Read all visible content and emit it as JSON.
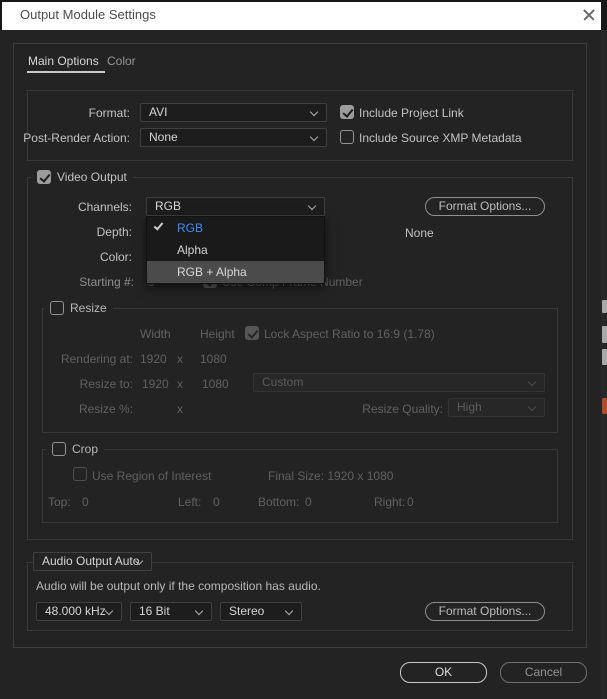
{
  "window": {
    "title": "Output Module Settings"
  },
  "tabs": [
    {
      "label": "Main Options",
      "active": true
    },
    {
      "label": "Color",
      "active": false
    }
  ],
  "format_section": {
    "format_label": "Format:",
    "format_value": "AVI",
    "post_render_label": "Post-Render Action:",
    "post_render_value": "None",
    "include_project_link": "Include Project Link",
    "include_project_link_checked": true,
    "include_xmp": "Include Source XMP Metadata",
    "include_xmp_checked": false
  },
  "video_output": {
    "legend": "Video Output",
    "checked": true,
    "channels_label": "Channels:",
    "channels_value": "RGB",
    "format_options_label": "Format Options...",
    "depth_label": "Depth:",
    "depth_right_text": "None",
    "color_label": "Color:",
    "starting_label": "Starting #:",
    "starting_value": "0",
    "use_comp_frame_label": "Use Comp Frame Number",
    "use_comp_frame_checked": true
  },
  "channels_menu": {
    "items": [
      {
        "label": "RGB",
        "checked": true,
        "state": "selected"
      },
      {
        "label": "Alpha",
        "checked": false,
        "state": "normal"
      },
      {
        "label": "RGB + Alpha",
        "checked": false,
        "state": "hover"
      }
    ]
  },
  "resize": {
    "legend": "Resize",
    "checked": false,
    "width_header": "Width",
    "height_header": "Height",
    "lock_label": "Lock Aspect Ratio to 16:9 (1.78)",
    "lock_checked": true,
    "rendering_label": "Rendering at:",
    "rendering_width": "1920",
    "rendering_height": "1080",
    "sep": "x",
    "resize_to_label": "Resize to:",
    "resize_to_width": "1920",
    "resize_to_height": "1080",
    "preset_value": "Custom",
    "resize_pct_label": "Resize %:",
    "quality_label": "Resize Quality:",
    "quality_value": "High"
  },
  "crop": {
    "legend": "Crop",
    "checked": false,
    "roi_label": "Use Region of Interest",
    "roi_checked": false,
    "final_size": "Final Size: 1920 x 1080",
    "top_label": "Top:",
    "top_value": "0",
    "left_label": "Left:",
    "left_value": "0",
    "bottom_label": "Bottom:",
    "bottom_value": "0",
    "right_label": "Right:",
    "right_value": "0"
  },
  "audio": {
    "mode_value": "Audio Output Auto",
    "note": "Audio will be output only if the composition has audio.",
    "sample_rate": "48.000 kHz",
    "bit_depth": "16 Bit",
    "channels": "Stereo",
    "format_options_label": "Format Options..."
  },
  "buttons": {
    "ok": "OK",
    "cancel": "Cancel"
  },
  "colors": {
    "dialog_bg": "#232323",
    "titlebar_bg": "#ffffff",
    "accent_blue": "#3e8cfa",
    "menu_highlight": "#4b4b4b",
    "checkbox_fill": "#9c9c9c",
    "fragment_gray": "#a9a9a9",
    "fragment_orange": "#b24a2e"
  }
}
